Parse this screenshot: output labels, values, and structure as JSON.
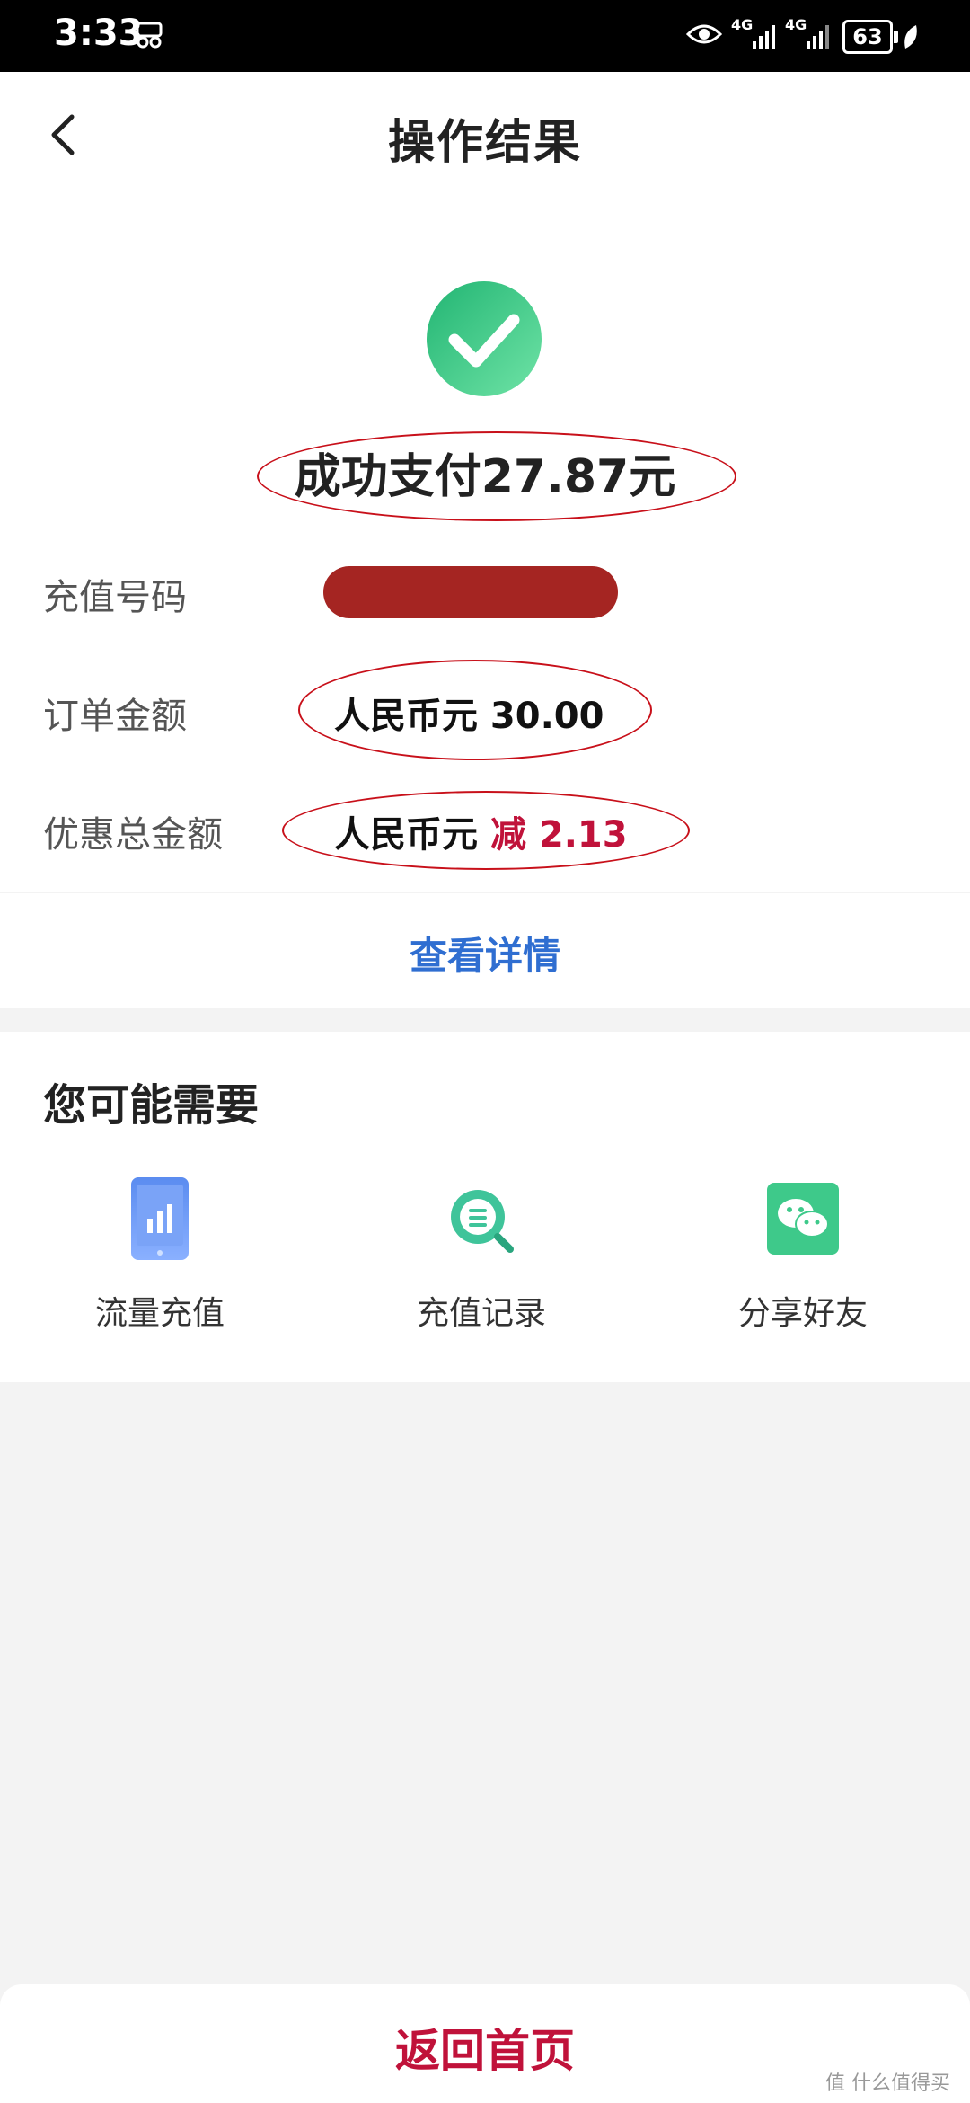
{
  "status_bar": {
    "time": "3:33",
    "network_1": "4G",
    "network_2": "4G",
    "battery": "63"
  },
  "header": {
    "title": "操作结果",
    "back_icon": "chevron-left-icon"
  },
  "result": {
    "success_icon": "check-circle-icon",
    "accent_color": "#3ecf8e",
    "payment_text": "成功支付27.87元",
    "rows": [
      {
        "label": "充值号码",
        "value": ""
      },
      {
        "label": "订单金额",
        "value": "人民币元 30.00"
      },
      {
        "label": "优惠总金额",
        "value_prefix": "人民币元",
        "value_highlight": "减 2.13"
      }
    ],
    "detail_link": "查看详情"
  },
  "recommendations": {
    "title": "您可能需要",
    "items": [
      {
        "label": "流量充值",
        "icon": "phone-data-icon"
      },
      {
        "label": "充值记录",
        "icon": "search-list-icon"
      },
      {
        "label": "分享好友",
        "icon": "wechat-icon"
      }
    ]
  },
  "bottom": {
    "home_button": "返回首页"
  },
  "watermark": "值 什么值得买"
}
